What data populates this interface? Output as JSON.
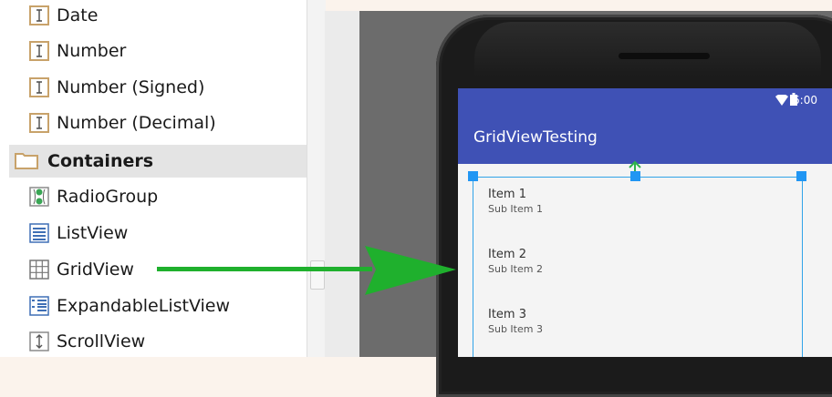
{
  "palette": {
    "widgets_top": [
      {
        "label": "Date",
        "icon": "text-field-icon"
      },
      {
        "label": "Number",
        "icon": "text-field-icon"
      },
      {
        "label": "Number (Signed)",
        "icon": "text-field-icon"
      },
      {
        "label": "Number (Decimal)",
        "icon": "text-field-icon"
      }
    ],
    "category": {
      "label": "Containers",
      "icon": "folder-icon"
    },
    "containers": [
      {
        "label": "RadioGroup",
        "icon": "radiogroup-icon"
      },
      {
        "label": "ListView",
        "icon": "listview-icon"
      },
      {
        "label": "GridView",
        "icon": "gridview-icon"
      },
      {
        "label": "ExpandableListView",
        "icon": "expandable-listview-icon"
      },
      {
        "label": "ScrollView",
        "icon": "scrollview-icon"
      }
    ]
  },
  "device": {
    "status_time": "6:00",
    "app_title": "GridViewTesting",
    "grid_items": [
      {
        "title": "Item 1",
        "subtitle": "Sub Item 1"
      },
      {
        "title": "Item 2",
        "subtitle": "Sub Item 2"
      },
      {
        "title": "Item 3",
        "subtitle": "Sub Item 3"
      }
    ]
  },
  "colors": {
    "app_bar": "#3f51b5",
    "arrow": "#1fb02d",
    "selection": "#2196f3",
    "palette_icon": "#c8a26a"
  }
}
